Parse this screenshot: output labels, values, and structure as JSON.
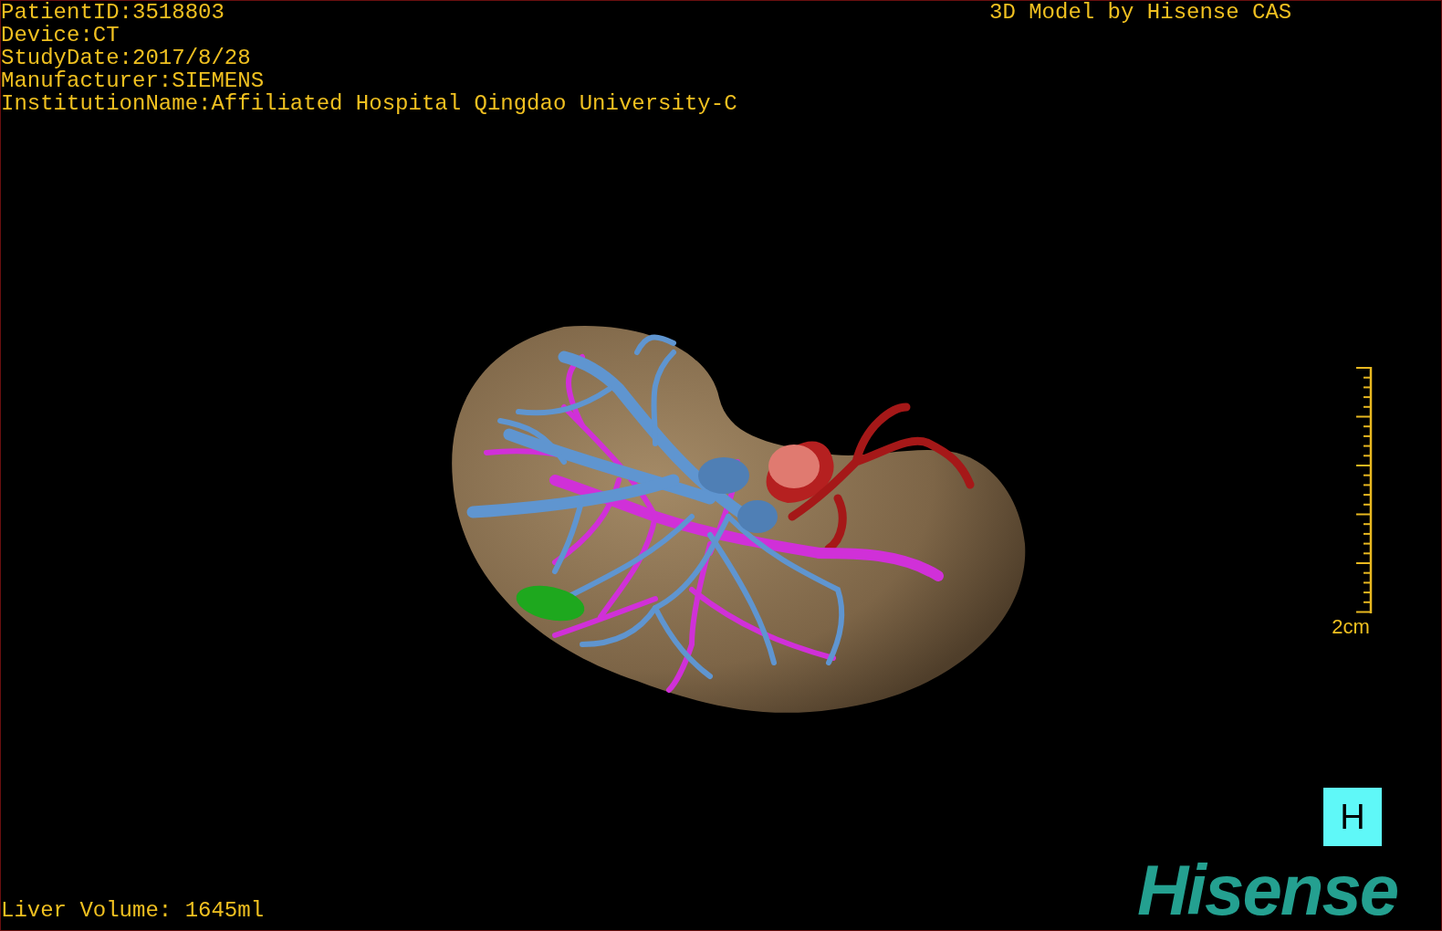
{
  "patient_info": [
    "PatientID:3518803",
    "Device:CT",
    "StudyDate:2017/8/28",
    "Manufacturer:SIEMENS",
    "InstitutionName:Affiliated Hospital Qingdao University-C"
  ],
  "title": "3D Model by Hisense CAS",
  "scale_label": "2cm",
  "h_button": {
    "label": "H"
  },
  "logo": "Hisense",
  "liver_volume": "Liver Volume: 1645ml"
}
